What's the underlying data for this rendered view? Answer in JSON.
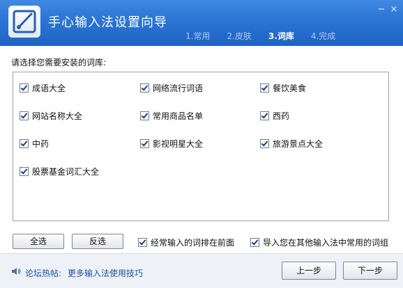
{
  "window": {
    "title": "手心输入法设置向导",
    "minimize": "−",
    "close": "×"
  },
  "steps": [
    {
      "label": "1.常用",
      "active": false
    },
    {
      "label": "2.皮肤",
      "active": false
    },
    {
      "label": "3.词库",
      "active": true
    },
    {
      "label": "4.完成",
      "active": false
    }
  ],
  "prompt": "请选择您需要安装的词库:",
  "dictionaries": [
    {
      "label": "成语大全",
      "checked": true
    },
    {
      "label": "网络流行词语",
      "checked": true
    },
    {
      "label": "餐饮美食",
      "checked": true
    },
    {
      "label": "网站名称大全",
      "checked": true
    },
    {
      "label": "常用商品名单",
      "checked": true
    },
    {
      "label": "西药",
      "checked": true
    },
    {
      "label": "中药",
      "checked": true
    },
    {
      "label": "影视明星大全",
      "checked": true
    },
    {
      "label": "旅游景点大全",
      "checked": true
    },
    {
      "label": "股票基金词汇大全",
      "checked": true
    }
  ],
  "buttons": {
    "select_all": "全选",
    "invert": "反选",
    "prev": "上一步",
    "next": "下一步"
  },
  "options": {
    "frequent_first": {
      "label": "经常输入的词排在前面",
      "checked": true
    },
    "import_other": {
      "label": "导入您在其他输入法中常用的词组",
      "checked": true
    }
  },
  "footer": {
    "label": "论坛热帖:",
    "link": "更多输入法使用技巧"
  }
}
